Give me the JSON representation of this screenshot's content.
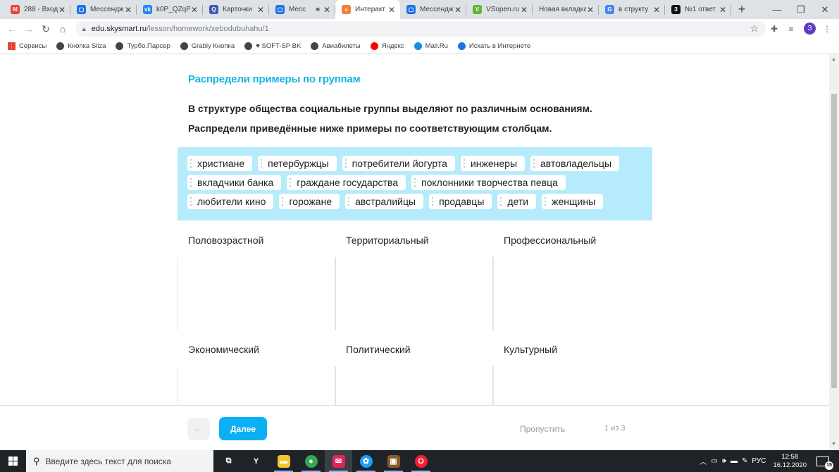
{
  "browser": {
    "tabs": [
      {
        "title": "288 - Вход",
        "icon": "gmail-icon",
        "color": "#ea4335",
        "glyph": "M",
        "active": false
      },
      {
        "title": "Мессендж",
        "icon": "messenger-icon",
        "color": "#1a73e8",
        "glyph": "▢",
        "active": false
      },
      {
        "title": "k0P_QZqP",
        "icon": "vk-icon",
        "color": "#2787f5",
        "glyph": "vk",
        "active": false
      },
      {
        "title": "Карточки",
        "icon": "quizlet-icon",
        "color": "#4257b2",
        "glyph": "Q",
        "active": false
      },
      {
        "title": "Месс",
        "icon": "messenger-icon",
        "color": "#1a73e8",
        "glyph": "▢",
        "active": false,
        "audio": true
      },
      {
        "title": "Интеракт",
        "icon": "skysmart-icon",
        "color": "#f0803c",
        "glyph": "»",
        "active": true
      },
      {
        "title": "Мессендж",
        "icon": "messenger-icon",
        "color": "#1a73e8",
        "glyph": "▢",
        "active": false
      },
      {
        "title": "VSopen.ru",
        "icon": "vsopen-icon",
        "color": "#5fb832",
        "glyph": "V",
        "active": false
      },
      {
        "title": "Новая вкладка",
        "icon": "",
        "color": "",
        "glyph": "",
        "active": false
      },
      {
        "title": "в структу",
        "icon": "google-icon",
        "color": "#4285f4",
        "glyph": "G",
        "active": false
      },
      {
        "title": "№1 ответ",
        "icon": "znanija-icon",
        "color": "#111111",
        "glyph": "З",
        "active": false
      }
    ],
    "new_tab": "+",
    "url_host": "edu.skysmart.ru",
    "url_path": "/lesson/homework/xebodubuhahu/1",
    "profile_initial": "З",
    "bookmarks": [
      {
        "label": "Сервисы",
        "icon": "apps-icon",
        "color": "#e94235"
      },
      {
        "label": "Кнопка Sliza",
        "icon": "globe-icon",
        "color": "#444444"
      },
      {
        "label": "Турбо.Парсер",
        "icon": "globe-icon",
        "color": "#444444"
      },
      {
        "label": "Grably Кнопка",
        "icon": "globe-icon",
        "color": "#444444"
      },
      {
        "label": "♥ SOFT-SP BK",
        "icon": "globe-icon",
        "color": "#444444"
      },
      {
        "label": "Авиабилеты",
        "icon": "globe-icon",
        "color": "#444444"
      },
      {
        "label": "Яндекс",
        "icon": "yandex-icon",
        "color": "#ff0000"
      },
      {
        "label": "Mail.Ru",
        "icon": "mailru-icon",
        "color": "#168de2"
      },
      {
        "label": "Искать в Интернете",
        "icon": "search-engine-icon",
        "color": "#1a73e8"
      }
    ]
  },
  "task": {
    "title": "Распредели примеры по группам",
    "instruction_1": "В структуре общества социальные группы выделяют по различным основаниям.",
    "instruction_2": "Распредели приведённые ниже примеры по соответствующим столбцам.",
    "chips": [
      "христиане",
      "петербуржцы",
      "потребители йогурта",
      "инженеры",
      "автовладельцы",
      "вкладчики банка",
      "граждане государства",
      "поклонники творчества певца",
      "любители кино",
      "горожане",
      "австралийцы",
      "продавцы",
      "дети",
      "женщины"
    ],
    "columns": [
      "Половозрастной",
      "Территориальный",
      "Профессиональный",
      "Экономический",
      "Политический",
      "Культурный"
    ]
  },
  "footer": {
    "back_arrow": "←",
    "next_label": "Далее",
    "skip_label": "Пропустить",
    "progress": "1 из 3"
  },
  "taskbar": {
    "search_placeholder": "Введите здесь текст для поиска",
    "apps": [
      {
        "name": "task-view-icon",
        "color": "#1f2327",
        "glyph": "⧉"
      },
      {
        "name": "yandex-browser-icon",
        "color": "#1f2327",
        "glyph": "Y"
      },
      {
        "name": "file-explorer-icon",
        "color": "#f4c430",
        "glyph": "▬"
      },
      {
        "name": "chrome-icon",
        "color": "#34a853",
        "glyph": "●"
      },
      {
        "name": "mail-app-icon",
        "color": "#e0245e",
        "glyph": "✉"
      },
      {
        "name": "steam-like-icon",
        "color": "#1a9fff",
        "glyph": "✿"
      },
      {
        "name": "minecraft-icon",
        "color": "#8b5a2b",
        "glyph": "▣"
      },
      {
        "name": "opera-icon",
        "color": "#ff1b2d",
        "glyph": "O"
      }
    ],
    "tray_language": "РУС",
    "time": "12:58",
    "date": "16.12.2020",
    "notifications": "15"
  }
}
